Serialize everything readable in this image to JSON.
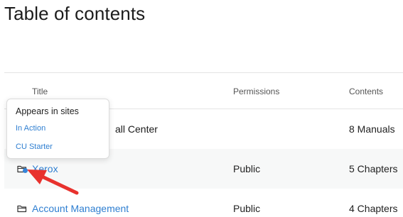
{
  "page": {
    "title": "Table of contents"
  },
  "table": {
    "headers": {
      "title": "Title",
      "permissions": "Permissions",
      "contents": "Contents"
    },
    "rows": [
      {
        "title": "all Center",
        "permissions": "",
        "contents": "8 Manuals"
      },
      {
        "title": "Xerox",
        "permissions": "Public",
        "contents": "5 Chapters"
      },
      {
        "title": "Account Management",
        "permissions": "Public",
        "contents": "4 Chapters"
      }
    ]
  },
  "popover": {
    "heading": "Appears in sites",
    "links": [
      "In Action",
      "CU Starter"
    ]
  },
  "icons": {
    "folder": "folder-icon",
    "indicator": "site-indicator-dot",
    "annotation": "red-arrow-annotation"
  },
  "colors": {
    "link": "#2f7fd1",
    "indicator": "#3585d9",
    "arrow": "#e8322e",
    "row_alt": "#f7f8f8"
  }
}
